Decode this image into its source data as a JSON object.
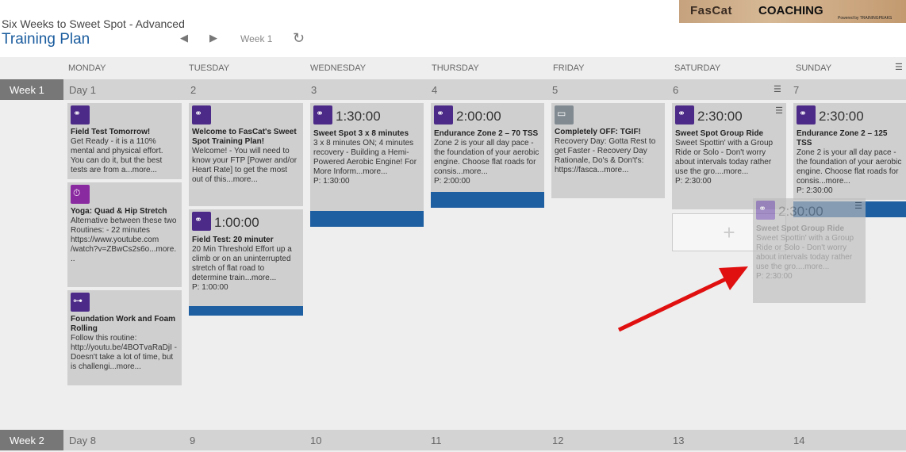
{
  "header": {
    "plan_subtitle": "Six Weeks to Sweet Spot - Advanced",
    "page_title": "Training Plan",
    "prev": "◀",
    "next": "▶",
    "week_label": "Week 1",
    "refresh": "↻"
  },
  "logo": {
    "brand": "FasCat",
    "coaching": "COACHING",
    "powered": "Powered by TRAININGPEAKS"
  },
  "days": [
    "MONDAY",
    "TUESDAY",
    "WEDNESDAY",
    "THURSDAY",
    "FRIDAY",
    "SATURDAY",
    "SUNDAY"
  ],
  "week1": {
    "label": "Week 1",
    "nums": [
      "Day 1",
      "2",
      "3",
      "4",
      "5",
      "6",
      "7"
    ]
  },
  "week2": {
    "label": "Week 2",
    "nums": [
      "Day 8",
      "9",
      "10",
      "11",
      "12",
      "13",
      "14"
    ]
  },
  "cards": {
    "mon1": {
      "title": "Field Test Tomorrow!",
      "body": "Get Ready - it is a 110% mental and physical effort. You can do it, but the best tests are from a...more..."
    },
    "mon2": {
      "title": "Yoga: Quad & Hip Stretch",
      "body": "Alternative between these two Routines: - 22 minutes https://www.youtube.com /watch?v=ZBwCs2s6o...more. .."
    },
    "mon3": {
      "title": "Foundation Work and Foam Rolling",
      "body": "Follow this routine: http://youtu.be/4BOTvaRaDjI - Doesn't take a lot of time, but is challengi...more..."
    },
    "tue1": {
      "title": "Welcome to FasCat's Sweet Spot Training Plan!",
      "body": "Welcome! - You will need to know your FTP [Power and/or Heart Rate] to get the most out of this...more..."
    },
    "tue2": {
      "dur": "1:00:00",
      "title": "Field Test: 20 minuter",
      "body": "20 Min Threshold Effort up a climb or on an uninterrupted stretch of flat road to determine train...more...",
      "p": "P: 1:00:00"
    },
    "wed1": {
      "dur": "1:30:00",
      "title": "Sweet Spot 3 x 8 minutes",
      "body": "3 x 8 minutes ON; 4 minutes recovery - Building a Hemi-Powered Aerobic Engine! For More Inform...more...",
      "p": "P: 1:30:00"
    },
    "thu1": {
      "dur": "2:00:00",
      "title": "Endurance Zone 2 – 70 TSS",
      "body": "Zone 2 is your all day pace - the foundation of your aerobic engine. Choose flat roads for consis...more...",
      "p": "P: 2:00:00"
    },
    "fri1": {
      "title": "Completely OFF: TGIF!",
      "body": "Recovery Day: Gotta Rest to get Faster - Recovery Day Rationale, Do's & Don't's: https://fasca...more..."
    },
    "sat1": {
      "dur": "2:30:00",
      "title": "Sweet Spot Group Ride",
      "body": "Sweet Spottin' with a Group Ride or Solo - Don't worry about intervals today rather use the gro....more...",
      "p": "P: 2:30:00"
    },
    "sun1": {
      "dur": "2:30:00",
      "title": "Endurance Zone 2 – 125 TSS",
      "body": "Zone 2 is your all day pace - the foundation of your aerobic engine. Choose flat roads for consis...more...",
      "p": "P: 2:30:00"
    },
    "drag": {
      "dur": "2:30:00",
      "title": "Sweet Spot Group Ride",
      "body": "Sweet Spottin' with a Group Ride or Solo - Don't worry about intervals today rather use the gro....more...",
      "p": "P: 2:30:00"
    }
  },
  "add_label": "+",
  "colors": {
    "accent": "#1a5c9e",
    "workout_bar": "#1e5fa1",
    "bike_icon": "#4c2a87",
    "arrow": "#e01010"
  }
}
